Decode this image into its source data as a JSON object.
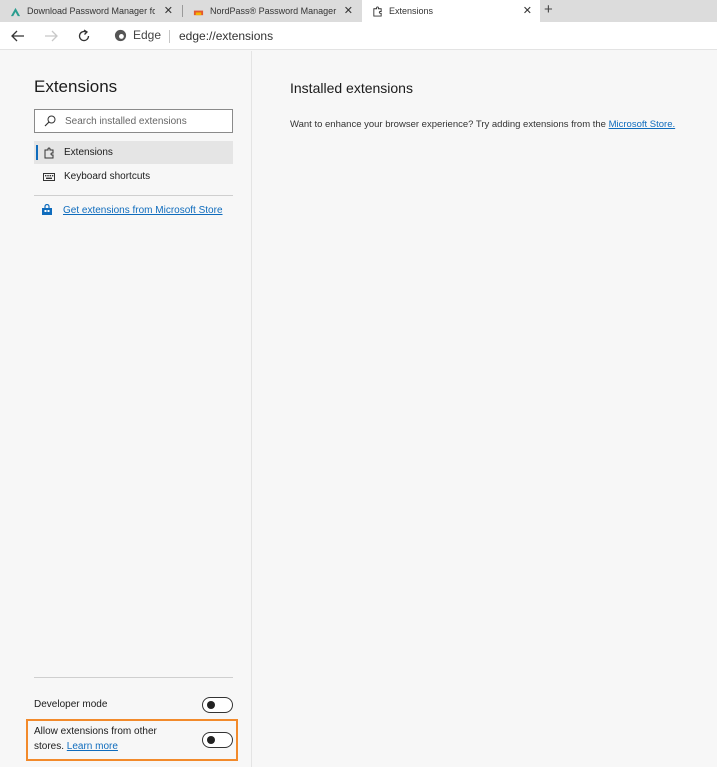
{
  "tabs": [
    {
      "title": "Download Password Manager fo",
      "active": false
    },
    {
      "title": "NordPass® Password Manager",
      "active": false
    },
    {
      "title": "Extensions",
      "active": true
    }
  ],
  "toolbar": {
    "site_label": "Edge",
    "url": "edge://extensions"
  },
  "sidebar": {
    "title": "Extensions",
    "search_placeholder": "Search installed extensions",
    "items": [
      {
        "label": "Extensions",
        "selected": true
      },
      {
        "label": "Keyboard shortcuts",
        "selected": false
      }
    ],
    "store_link": "Get extensions from Microsoft Store",
    "developer_mode": {
      "label": "Developer mode",
      "enabled": false
    },
    "allow_other_stores": {
      "label": "Allow extensions from other stores.",
      "link": "Learn more",
      "enabled": false
    }
  },
  "main": {
    "title": "Installed extensions",
    "text": "Want to enhance your browser experience? Try adding extensions from the ",
    "link": "Microsoft Store."
  },
  "colors": {
    "accent": "#0f6cbd",
    "highlight": "#f28a2b"
  }
}
